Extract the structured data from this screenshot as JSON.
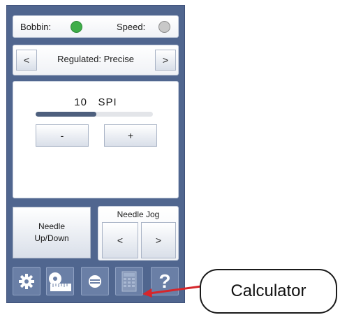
{
  "status": {
    "bobbin_label": "Bobbin:",
    "speed_label": "Speed:",
    "bobbin_indicator_color": "#3fae49",
    "speed_indicator_color": "#c8c8c8"
  },
  "mode": {
    "prev_label": "<",
    "next_label": ">",
    "current": "Regulated: Precise"
  },
  "stitch": {
    "value": "10",
    "unit": "SPI",
    "level_fraction": 0.52,
    "decrease_label": "-",
    "increase_label": "+"
  },
  "needle": {
    "up_down_line1": "Needle",
    "up_down_line2": "Up/Down",
    "jog_title": "Needle Jog",
    "jog_left_label": "<",
    "jog_right_label": ">"
  },
  "toolbar": {
    "icons": [
      "gear-icon",
      "measure-tape-icon",
      "bobbin-icon",
      "calculator-icon",
      "help-icon"
    ],
    "help_label": "?"
  },
  "callout": {
    "label": "Calculator",
    "arrow_color": "#d6262b"
  }
}
